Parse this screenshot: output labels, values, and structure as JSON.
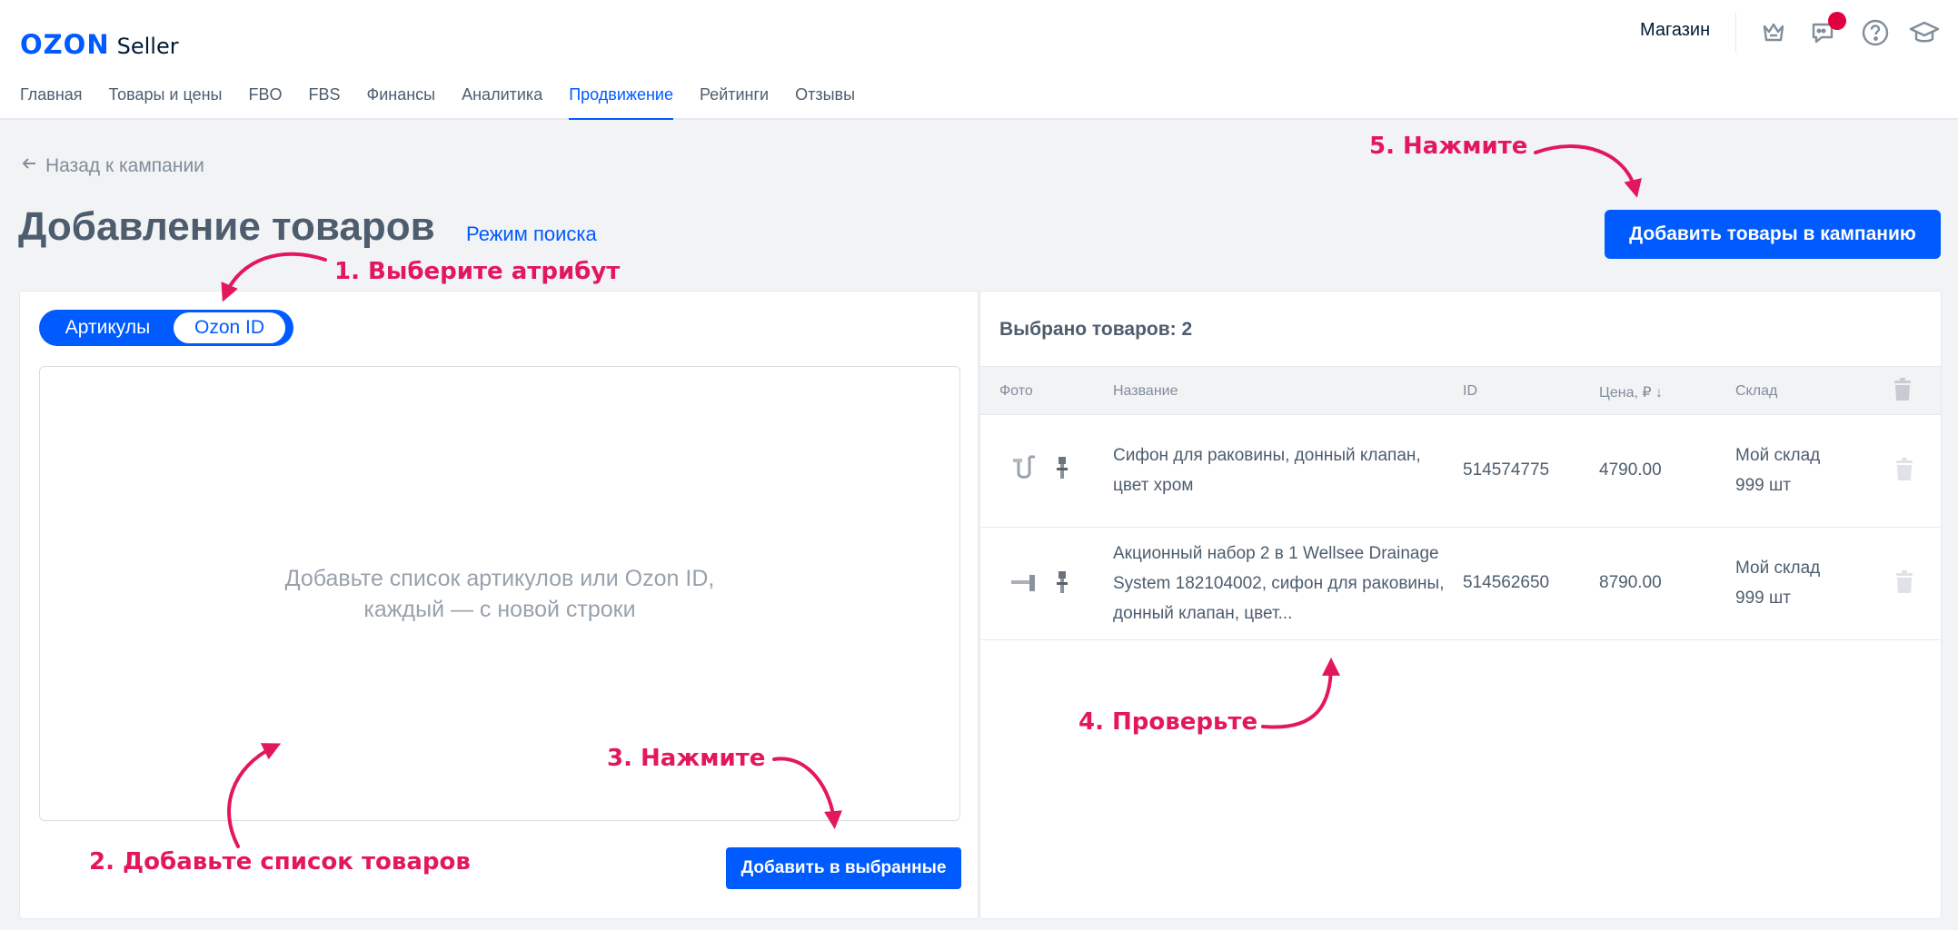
{
  "brand": {
    "name": "OZON",
    "product": "Seller",
    "accent": "#005bff",
    "annotation_color": "#e3175d"
  },
  "header": {
    "store_label": "Магазин",
    "icons": [
      "crown-icon",
      "chat-icon",
      "help-icon",
      "academy-icon"
    ],
    "nav": [
      {
        "label": "Главная",
        "active": false
      },
      {
        "label": "Товары и цены",
        "active": false
      },
      {
        "label": "FBO",
        "active": false
      },
      {
        "label": "FBS",
        "active": false
      },
      {
        "label": "Финансы",
        "active": false
      },
      {
        "label": "Аналитика",
        "active": false
      },
      {
        "label": "Продвижение",
        "active": true
      },
      {
        "label": "Рейтинги",
        "active": false
      },
      {
        "label": "Отзывы",
        "active": false
      }
    ]
  },
  "page": {
    "back_link": "Назад к кампании",
    "title": "Добавление товаров",
    "search_mode": "Режим поиска",
    "add_to_campaign": "Добавить товары в кампанию"
  },
  "left_panel": {
    "toggle": {
      "option_1": "Артикулы",
      "option_2": "Ozon ID",
      "selected": "Ozon ID"
    },
    "placeholder": "Добавьте список артикулов или Ozon ID, каждый — с новой строки",
    "add_selected": "Добавить в выбранные"
  },
  "right_panel": {
    "selected_count": "Выбрано товаров: 2",
    "columns": {
      "photo": "Фото",
      "name": "Название",
      "id": "ID",
      "price": "Цена, ₽ ↓",
      "warehouse": "Склад"
    },
    "rows": [
      {
        "name": "Сифон для раковины, донный клапан, цвет хром",
        "id": "514574775",
        "price": "4790.00",
        "warehouse": "Мой склад",
        "qty": "999 шт"
      },
      {
        "name": "Акционный набор 2 в 1 Wellsee Drainage System 182104002, сифон для раковины, донный клапан, цвет...",
        "id": "514562650",
        "price": "8790.00",
        "warehouse": "Мой склад",
        "qty": "999 шт"
      }
    ]
  },
  "annotations": {
    "step1": "1. Выберите атрибут",
    "step2": "2. Добавьте список товаров",
    "step3": "3. Нажмите",
    "step4": "4. Проверьте",
    "step5": "5. Нажмите"
  }
}
